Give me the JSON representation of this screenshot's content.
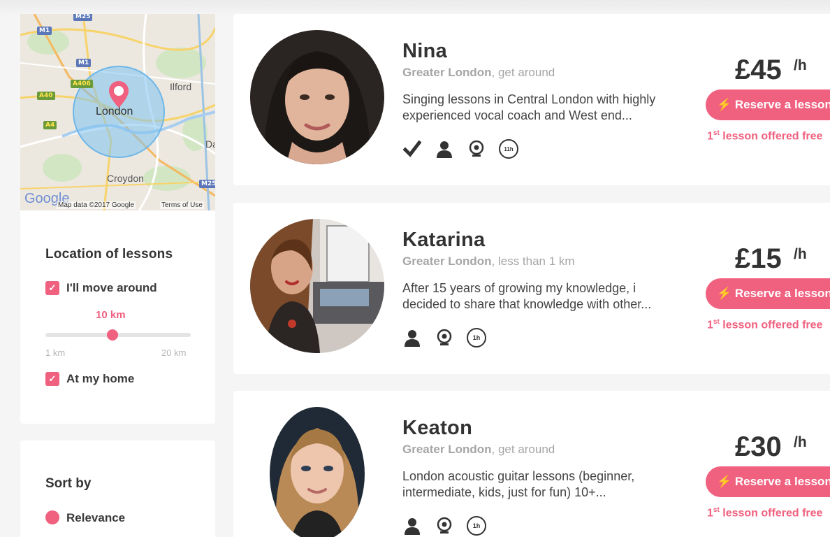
{
  "map": {
    "labels": {
      "ilford": "Ilford",
      "london": "London",
      "croydon": "Croydon",
      "da": "Da"
    },
    "roads": {
      "m25_top": "M25",
      "m1a": "M1",
      "m1b": "M1",
      "a406": "A406",
      "a40": "A40",
      "a4": "A4",
      "m25_right": "M25"
    },
    "attribution": "Map data ©2017 Google",
    "terms": "Terms of Use",
    "google_logo": "Google"
  },
  "filters": {
    "title": "Location of lessons",
    "move_around_label": "I'll move around",
    "radius_value": "10 km",
    "radius_fraction": 0.47,
    "min_label": "1 km",
    "max_label": "20 km",
    "at_home_label": "At my home"
  },
  "sort": {
    "title": "Sort by",
    "relevance_label": "Relevance"
  },
  "tutors": [
    {
      "name": "Nina",
      "area": "Greater London",
      "distance": ", get around",
      "description": "Singing lessons in Central London with highly experienced vocal coach and West end...",
      "price": "£45",
      "per": "/h",
      "reserve_label": "Reserve a lesson",
      "free_num": "1",
      "free_sup": "st",
      "free_text": " lesson offered free"
    },
    {
      "name": "Katarina",
      "area": "Greater London",
      "distance": ", less than 1 km",
      "description": "After 15 years of growing my knowledge, i decided to share that knowledge with other...",
      "price": "£15",
      "per": "/h",
      "reserve_label": "Reserve a lesson",
      "free_num": "1",
      "free_sup": "st",
      "free_text": " lesson offered free"
    },
    {
      "name": "Keaton",
      "area": "Greater London",
      "distance": ", get around",
      "description": "London acoustic guitar lessons (beginner, intermediate, kids, just for fun) 10+...",
      "price": "£30",
      "per": "/h",
      "reserve_label": "Reserve a lesson",
      "free_num": "1",
      "free_sup": "st",
      "free_text": " lesson offered free"
    }
  ],
  "icons": {
    "check": "check-icon",
    "person": "person-icon",
    "webcam": "webcam-icon",
    "hour_badge": "1h",
    "hour_badge_nina": "11h"
  },
  "colors": {
    "accent": "#f0607f",
    "map_circle": "#7ec3f0"
  }
}
